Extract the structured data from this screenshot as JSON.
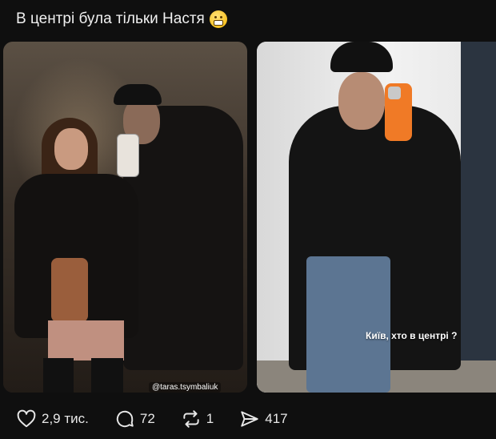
{
  "post": {
    "caption": "В центрі була тільки Настя",
    "caption_emoji": "grimacing-face-emoji"
  },
  "media": {
    "left_watermark": "@taras.tsymbaliuk",
    "right_story_text": "Київ, хто в центрі ?"
  },
  "actions": {
    "likes": "2,9 тис.",
    "comments": "72",
    "reposts": "1",
    "shares": "417"
  },
  "icons": [
    "heart-icon",
    "comment-icon",
    "repost-icon",
    "share-icon"
  ],
  "colors": {
    "background": "#0f0f0f",
    "text": "#f2f2f2",
    "phone_orange": "#f07a26"
  }
}
